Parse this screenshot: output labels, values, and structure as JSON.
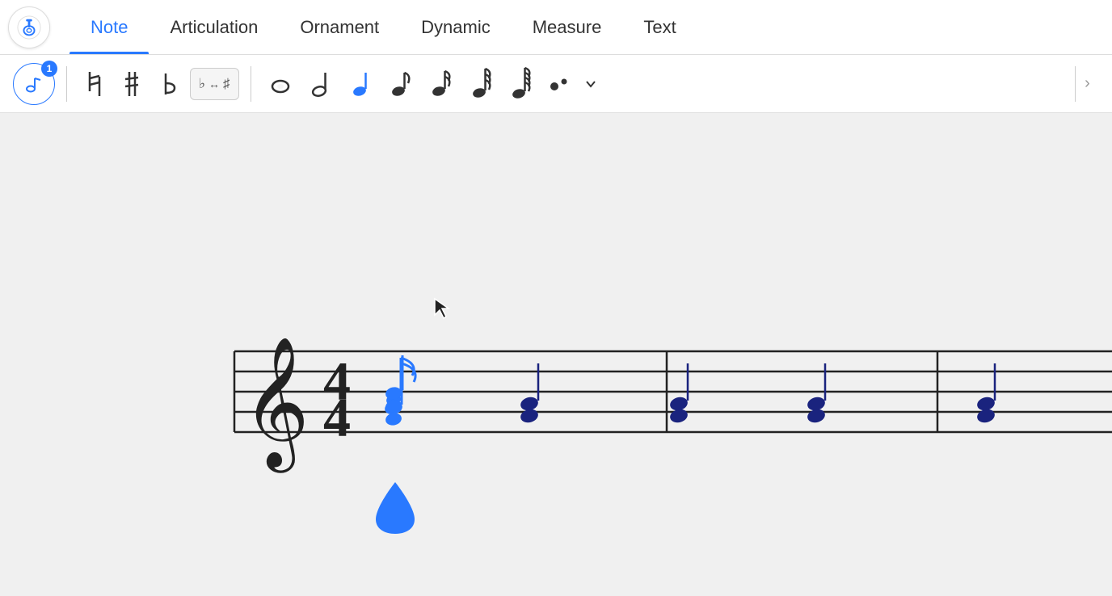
{
  "appIcon": {
    "label": "music app icon"
  },
  "navTabs": [
    {
      "id": "note",
      "label": "Note",
      "active": true
    },
    {
      "id": "articulation",
      "label": "Articulation",
      "active": false
    },
    {
      "id": "ornament",
      "label": "Ornament",
      "active": false
    },
    {
      "id": "dynamic",
      "label": "Dynamic",
      "active": false
    },
    {
      "id": "measure",
      "label": "Measure",
      "active": false
    },
    {
      "id": "text",
      "label": "Text",
      "active": false
    }
  ],
  "toolbar": {
    "noteInputBadge": "1",
    "natural": "♮",
    "sharp": "♯",
    "flat": "♭",
    "enharmonic": "♭↔♯",
    "durations": [
      {
        "id": "whole",
        "symbol": "𝅝",
        "unicode": "○"
      },
      {
        "id": "half",
        "symbol": "𝅗𝅥",
        "unicode": "𝅗𝅥"
      },
      {
        "id": "quarter-active",
        "symbol": "♩",
        "unicode": "♩"
      },
      {
        "id": "eighth",
        "symbol": "♪",
        "unicode": "♪"
      },
      {
        "id": "sixteenth",
        "symbol": "𝅘𝅥𝅯",
        "unicode": "𝅘𝅥𝅯"
      },
      {
        "id": "thirtysecond",
        "symbol": "𝅘𝅥𝅰",
        "unicode": "𝅘𝅥𝅰"
      },
      {
        "id": "sixtyfourth",
        "symbol": "𝅘𝅥𝅱",
        "unicode": "𝅘𝅥𝅱"
      }
    ]
  },
  "colors": {
    "blue": "#2979ff",
    "darkBlue": "#1a237e",
    "black": "#222",
    "gray": "#888",
    "lightGray": "#e0e0e0"
  }
}
